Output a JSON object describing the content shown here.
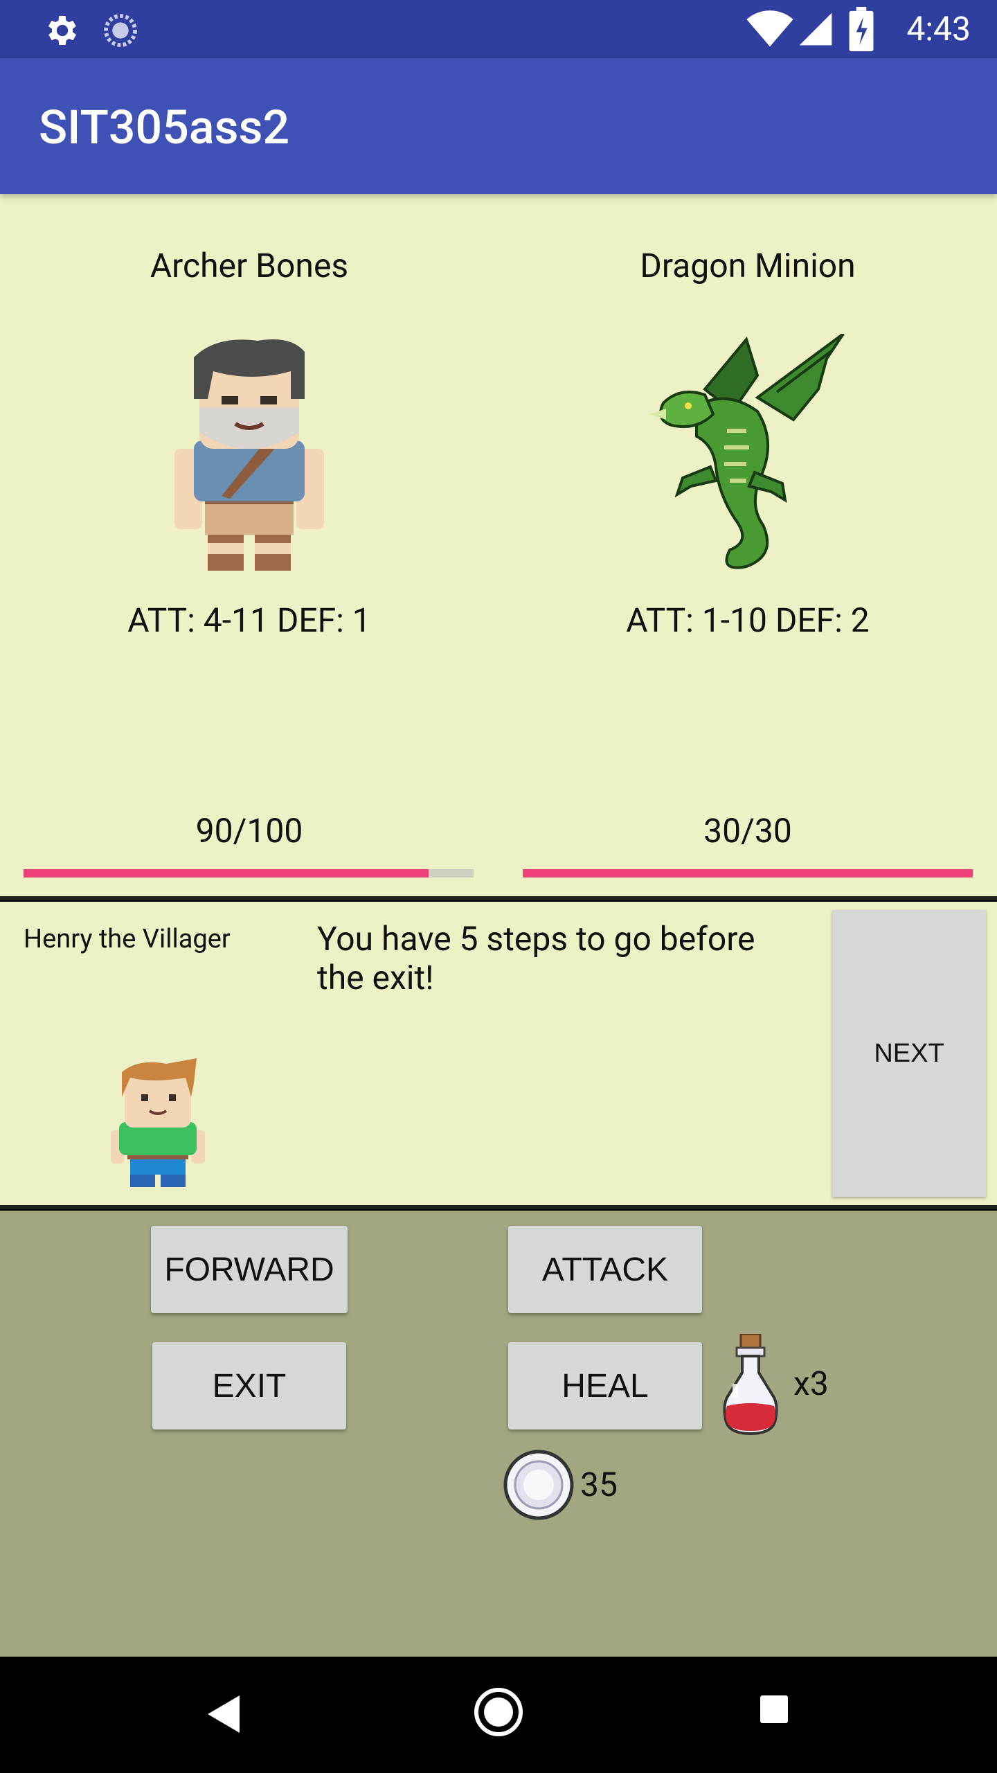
{
  "status_bar": {
    "time": "4:43",
    "icons": [
      "settings-icon",
      "sync-icon",
      "wifi-icon",
      "signal-icon",
      "battery-icon"
    ]
  },
  "app_bar": {
    "title": "SIT305ass2"
  },
  "player": {
    "name": "Archer Bones",
    "stats": "ATT: 4-11 DEF: 1",
    "hp_text": "90/100",
    "hp_fraction": 0.9
  },
  "enemy": {
    "name": "Dragon Minion",
    "stats": "ATT: 1-10 DEF: 2",
    "hp_text": "30/30",
    "hp_fraction": 1.0
  },
  "dialogue": {
    "npc_name": "Henry the Villager",
    "message": "You have 5 steps to go before the exit!",
    "next_label": "NEXT"
  },
  "controls": {
    "forward_label": "FORWARD",
    "attack_label": "ATTACK",
    "exit_label": "EXIT",
    "heal_label": "HEAL",
    "potion_count": "x3",
    "coin_count": "35"
  },
  "colors": {
    "status_bar": "#303F9F",
    "app_bar": "#3F51B5",
    "battle_bg": "#EEF0C6",
    "controls_bg": "#A3A680",
    "hp_bar": "#F0407A"
  }
}
